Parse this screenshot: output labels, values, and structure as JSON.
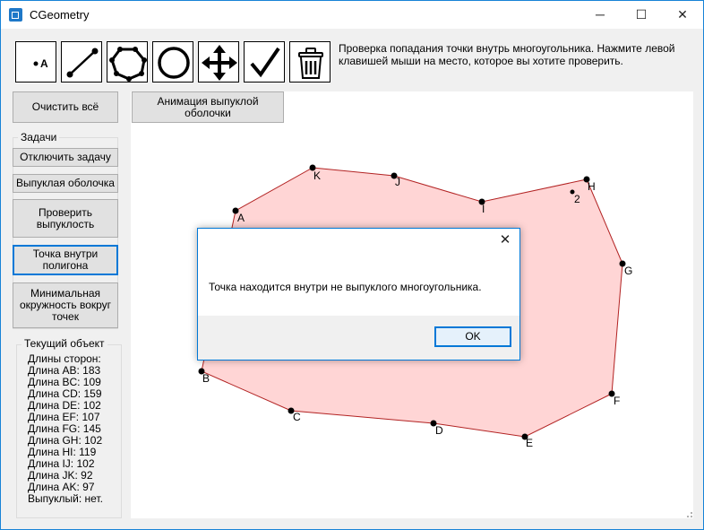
{
  "window": {
    "title": "CGeometry",
    "minimize_glyph": "─",
    "maximize_glyph": "☐",
    "close_glyph": "✕"
  },
  "toolbar": {
    "tools": [
      {
        "icon": "point-tool-icon",
        "label": "A"
      },
      {
        "icon": "segment-tool-icon"
      },
      {
        "icon": "polygon-tool-icon"
      },
      {
        "icon": "circle-tool-icon"
      },
      {
        "icon": "move-tool-icon"
      },
      {
        "icon": "check-tool-icon"
      },
      {
        "icon": "trash-icon"
      }
    ],
    "hint": "Проверка попадания точки внутрь многоугольника. Нажмите левой клавишей мыши на место, которое вы хотите проверить."
  },
  "sidebar": {
    "clear_all": "Очистить всё",
    "tasks_title": "Задачи",
    "tasks": [
      {
        "label": "Отключить задачу"
      },
      {
        "label": "Выпуклая оболочка"
      },
      {
        "label": "Проверить выпуклость"
      },
      {
        "label": "Точка внутри полигона"
      },
      {
        "label": "Минимальная окружность вокруг точек"
      }
    ],
    "current_title": "Текущий объект",
    "stats": [
      "Длины сторон:",
      "Длина AB: 183",
      "Длина BC: 109",
      "Длина CD: 159",
      "Длина DE: 102",
      "Длина EF: 107",
      "Длина FG: 145",
      "Длина GH: 102",
      "Длина HI: 119",
      "Длина IJ: 102",
      "Длина JK: 92",
      "Длина AK: 97",
      "Выпуклый: нет."
    ]
  },
  "canvas": {
    "animation_button": "Анимация выпуклой оболочки",
    "polygon_fill": "#ffd5d5",
    "polygon_stroke": "#b22222",
    "vertex_labels": [
      "A",
      "B",
      "C",
      "D",
      "E",
      "F",
      "G",
      "H",
      "I",
      "J",
      "K"
    ],
    "test_point_label": "2"
  },
  "dialog": {
    "message": "Точка находится внутри не выпуклого многоугольника.",
    "ok_label": "OK",
    "close_glyph": "✕"
  }
}
